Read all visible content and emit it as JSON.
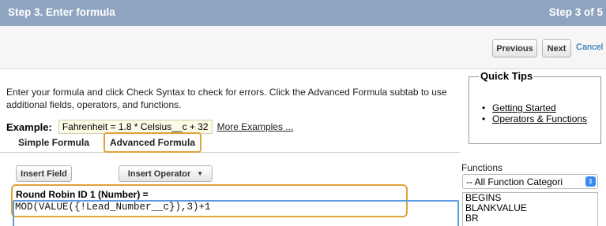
{
  "header": {
    "title": "Step 3. Enter formula",
    "step": "Step 3 of 5"
  },
  "buttons": {
    "previous": "Previous",
    "next": "Next",
    "cancel": "Cancel"
  },
  "intro": "Enter your formula and click Check Syntax to check for errors. Click the Advanced Formula subtab to use additional fields, operators, and functions.",
  "example": {
    "label": "Example:",
    "formula": "Fahrenheit = 1.8 * Celsius__c + 32",
    "more_link": "More Examples ..."
  },
  "tabs": {
    "simple": "Simple Formula",
    "advanced": "Advanced Formula"
  },
  "quick_tips": {
    "title": "Quick Tips",
    "items": [
      "Getting Started",
      "Operators & Functions"
    ]
  },
  "editor": {
    "insert_field": "Insert Field",
    "insert_operator": "Insert Operator",
    "formula_label": "Round Robin ID 1 (Number) =",
    "formula": "MOD(VALUE({!Lead_Number__c}),3)+1"
  },
  "functions": {
    "label": "Functions",
    "category_selected": "-- All Function Categori",
    "items": [
      "BEGINS",
      "BLANKVALUE",
      "BR"
    ]
  },
  "colors": {
    "header_bg": "#8fa4c1",
    "highlight_orange": "#e0a23a",
    "editor_focus_blue": "#5b9be0",
    "link_blue": "#015ba7"
  }
}
